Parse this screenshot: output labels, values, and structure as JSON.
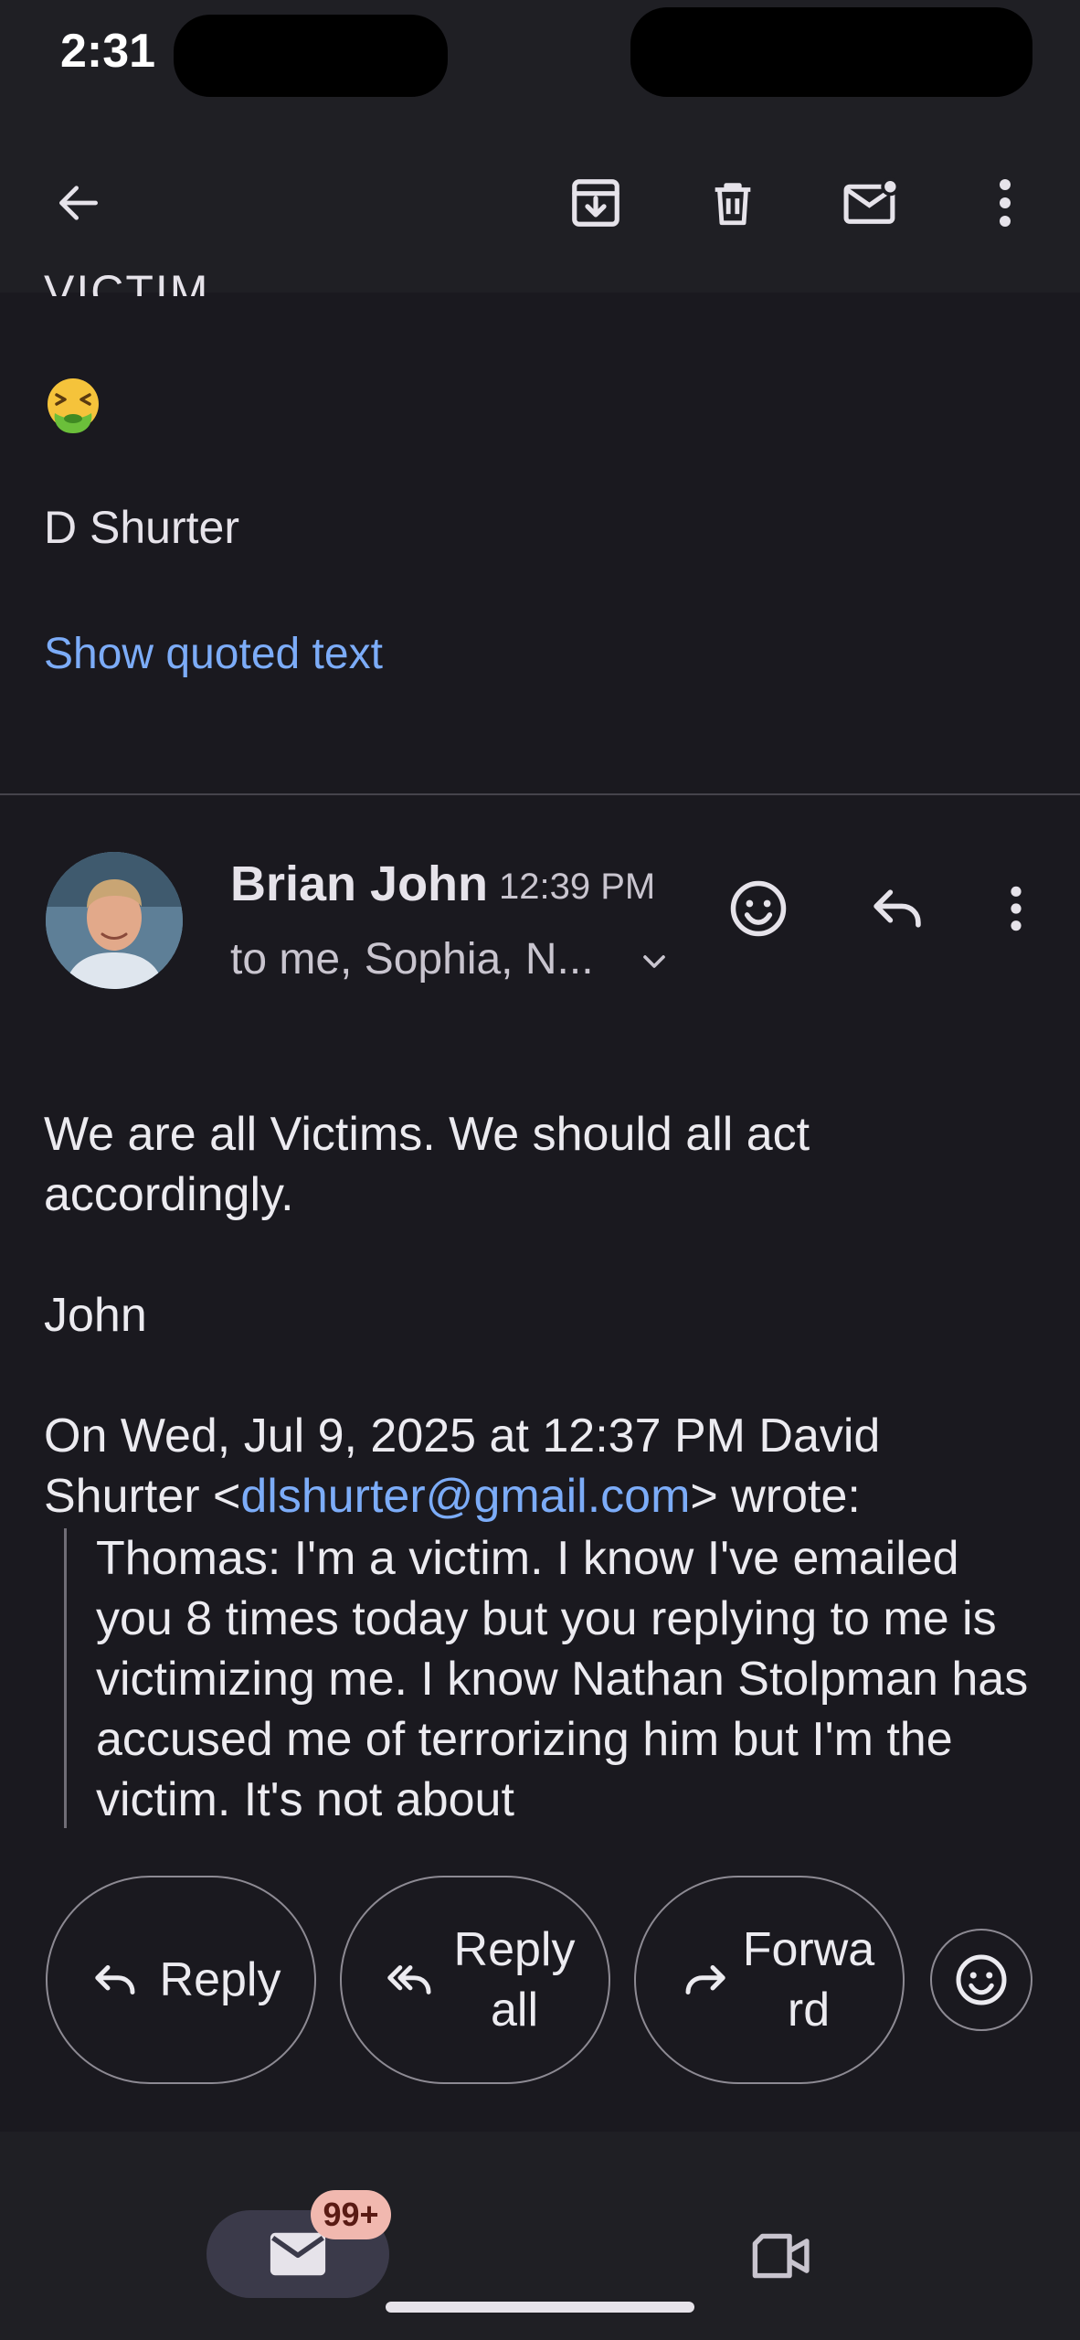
{
  "status_bar": {
    "time": "2:31"
  },
  "toolbar": {
    "back_icon": "arrow-left-icon",
    "archive_icon": "archive-icon",
    "delete_icon": "trash-icon",
    "mark_unread_icon": "mail-unread-icon",
    "more_icon": "more-vert-icon"
  },
  "previous_message": {
    "clipped_text": "VICTIM.",
    "emoji": "nauseated-face-emoji",
    "signature": "D Shurter",
    "show_quoted_label": "Show quoted text"
  },
  "message": {
    "sender": "Brian John",
    "time": "12:39 PM",
    "recipients": "to me, Sophia, N...",
    "body_line1": "We are all Victims. We should all act accordingly.",
    "body_signoff": "John",
    "attribution_prefix": "On Wed, Jul 9, 2025 at 12:37 PM David Shurter <",
    "attribution_email": "dlshurter@gmail.com",
    "attribution_suffix": "> wrote:",
    "quoted_text": "Thomas: I'm a victim. I know I've emailed you 8 times today but you replying to me is victimizing me. I know Nathan Stolpman has accused me of terrorizing him but I'm the victim. It's not about"
  },
  "actions": {
    "reply_label": "Reply",
    "reply_all_line1": "Reply",
    "reply_all_line2": "all",
    "forward_line1": "Forwa",
    "forward_line2": "rd"
  },
  "bottom_nav": {
    "mail_badge": "99+"
  },
  "colors": {
    "background": "#1a191f",
    "link": "#7cacf8",
    "badge": "#f1b8af"
  }
}
